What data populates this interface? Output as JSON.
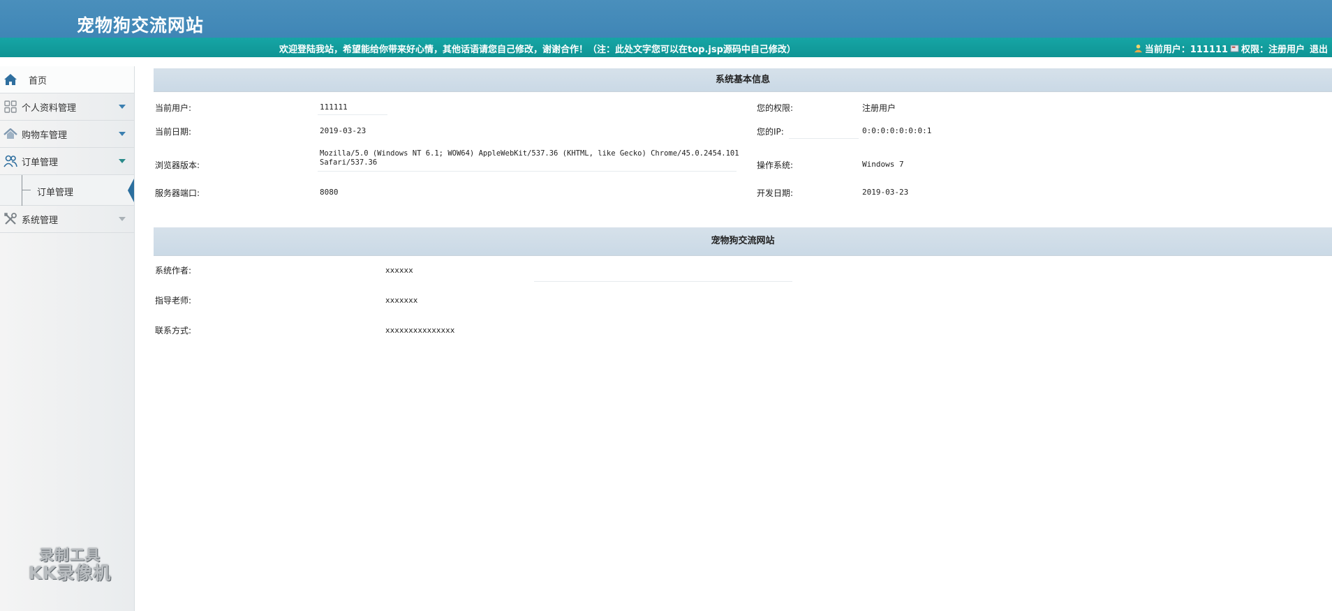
{
  "header": {
    "title": "宠物狗交流网站",
    "notice": "欢迎登陆我站，希望能给你带来好心情，其他话语请您自己修改，谢谢合作！（注：此处文字您可以在top.jsp源码中自己修改）",
    "current_user_label": "当前用户：111111",
    "permission_label": "权限：注册用户",
    "logout_label": "退出"
  },
  "sidebar": {
    "items": [
      {
        "label": "首页",
        "icon": "home-icon"
      },
      {
        "label": "个人资料管理",
        "icon": "grid-icon"
      },
      {
        "label": "购物车管理",
        "icon": "house-icon"
      },
      {
        "label": "订单管理",
        "icon": "users-icon"
      },
      {
        "label": "系统管理",
        "icon": "tools-icon"
      }
    ],
    "subitems": [
      {
        "label": "订单管理"
      }
    ]
  },
  "system_info": {
    "title": "系统基本信息",
    "rows": [
      {
        "label1": "当前用户:",
        "value1": "111111",
        "label2": "您的权限:",
        "value2": "注册用户"
      },
      {
        "label1": "当前日期:",
        "value1": "2019-03-23",
        "label2": "您的IP:",
        "value2": "0:0:0:0:0:0:0:1"
      },
      {
        "label1": "浏览器版本:",
        "value1": "Mozilla/5.0 (Windows NT 6.1; WOW64) AppleWebKit/537.36 (KHTML, like Gecko) Chrome/45.0.2454.101",
        "value1b": "Safari/537.36",
        "label2": "操作系统:",
        "value2": "Windows 7"
      },
      {
        "label1": "服务器端口:",
        "value1": "8080",
        "label2": "开发日期:",
        "value2": "2019-03-23"
      }
    ]
  },
  "site_info": {
    "title": "宠物狗交流网站",
    "rows": [
      {
        "label": "系统作者:",
        "value": "xxxxxx"
      },
      {
        "label": "指导老师:",
        "value": "xxxxxxx"
      },
      {
        "label": "联系方式:",
        "value": "xxxxxxxxxxxxxxx"
      }
    ]
  },
  "watermark": {
    "line1": "录制工具",
    "line2": "KK录像机"
  },
  "colors": {
    "header_bg": "#4a8fbc",
    "notice_bg": "#16a5a5",
    "section_title_bg": "#cad9e6",
    "accent": "#2c6f9e"
  }
}
